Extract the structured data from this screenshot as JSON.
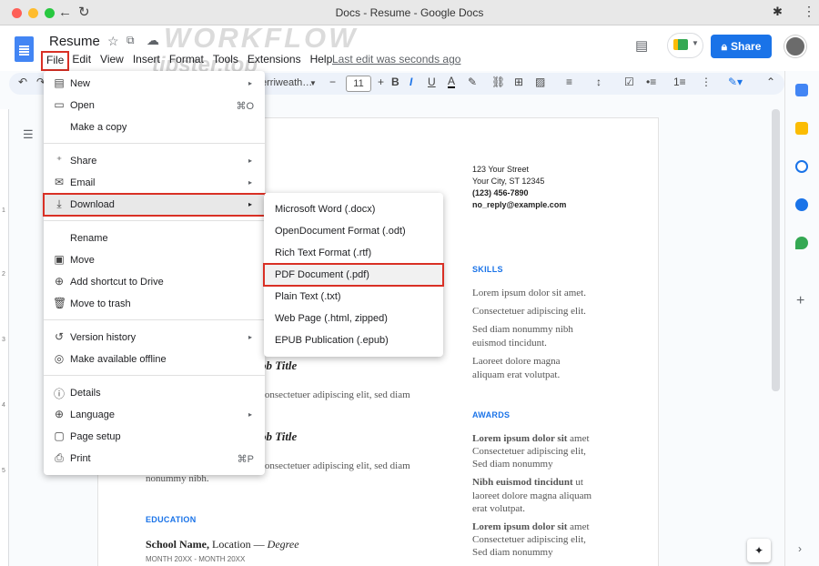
{
  "window": {
    "title": "Docs - Resume - Google Docs"
  },
  "header": {
    "doc_title": "Resume",
    "watermark_top": "WORKFLOW",
    "watermark_bottom": "tipster.top",
    "menus": [
      "File",
      "Edit",
      "View",
      "Insert",
      "Format",
      "Tools",
      "Extensions",
      "Help"
    ],
    "last_edit": "Last edit was seconds ago",
    "share_label": "Share"
  },
  "toolbar": {
    "font": "erriweath…",
    "size": "11"
  },
  "ruler_numbers": [
    "1",
    "2",
    "3",
    "4",
    "5"
  ],
  "file_menu": {
    "items": [
      {
        "icon": "▤",
        "label": "New",
        "shortcut": "",
        "arrow": "▸"
      },
      {
        "icon": "▭",
        "label": "Open",
        "shortcut": "⌘O",
        "arrow": ""
      },
      {
        "icon": "",
        "label": "Make a copy",
        "shortcut": "",
        "arrow": ""
      },
      {
        "icon": "⁺",
        "label": "Share",
        "shortcut": "",
        "arrow": "▸"
      },
      {
        "icon": "✉",
        "label": "Email",
        "shortcut": "",
        "arrow": "▸"
      },
      {
        "icon": "⤓",
        "label": "Download",
        "shortcut": "",
        "arrow": "▸"
      },
      {
        "icon": "",
        "label": "Rename",
        "shortcut": "",
        "arrow": ""
      },
      {
        "icon": "▣",
        "label": "Move",
        "shortcut": "",
        "arrow": ""
      },
      {
        "icon": "⊕",
        "label": "Add shortcut to Drive",
        "shortcut": "",
        "arrow": ""
      },
      {
        "icon": "🗑",
        "label": "Move to trash",
        "shortcut": "",
        "arrow": ""
      },
      {
        "icon": "↺",
        "label": "Version history",
        "shortcut": "",
        "arrow": "▸"
      },
      {
        "icon": "◎",
        "label": "Make available offline",
        "shortcut": "",
        "arrow": ""
      },
      {
        "icon": "ⓘ",
        "label": "Details",
        "shortcut": "",
        "arrow": ""
      },
      {
        "icon": "⊕",
        "label": "Language",
        "shortcut": "",
        "arrow": "▸"
      },
      {
        "icon": "▢",
        "label": "Page setup",
        "shortcut": "",
        "arrow": ""
      },
      {
        "icon": "⎙",
        "label": "Print",
        "shortcut": "⌘P",
        "arrow": ""
      }
    ]
  },
  "download_menu": {
    "items": [
      "Microsoft Word (.docx)",
      "OpenDocument Format (.odt)",
      "Rich Text Format (.rtf)",
      "PDF Document (.pdf)",
      "Plain Text (.txt)",
      "Web Page (.html, zipped)",
      "EPUB Publication (.epub)"
    ]
  },
  "document": {
    "contact": [
      "123 Your Street",
      "Your City, ST 12345",
      "(123) 456-7890",
      "no_reply@example.com"
    ],
    "skills_heading": "SKILLS",
    "skills": [
      "Lorem ipsum dolor sit amet.",
      "Consectetuer adipiscing elit.",
      "Sed diam nonummy nibh",
      "euismod tincidunt.",
      "Laoreet dolore magna",
      "aliquam erat volutpat."
    ],
    "awards_heading": "AWARDS",
    "awards": [
      {
        "bold": "Lorem ipsum dolor sit",
        "rest": " amet"
      },
      {
        "bold": "",
        "rest": "Consectetuer adipiscing elit,"
      },
      {
        "bold": "",
        "rest": "Sed diam nonummy"
      },
      {
        "bold": "Nibh euismod tincidunt",
        "rest": " ut"
      },
      {
        "bold": "",
        "rest": "laoreet dolore magna aliquam"
      },
      {
        "bold": "",
        "rest": "erat volutpat."
      },
      {
        "bold": "Lorem ipsum dolor sit",
        "rest": " amet"
      },
      {
        "bold": "",
        "rest": "Consectetuer adipiscing elit,"
      },
      {
        "bold": "",
        "rest": "Sed diam nonummy"
      }
    ],
    "job_title_1": "ob Title",
    "job_desc_1": "consectetuer adipiscing elit, sed diam",
    "job_title_2": "ob Title",
    "job_desc_2": "consectetuer adipiscing elit, sed diam",
    "job_desc_2b": "nonummy nibh.",
    "education_heading": "EDUCATION",
    "school": "School Name,",
    "school_loc": " Location — ",
    "degree": "Degree",
    "school_dates": "MONTH 20XX - MONTH 20XX"
  }
}
